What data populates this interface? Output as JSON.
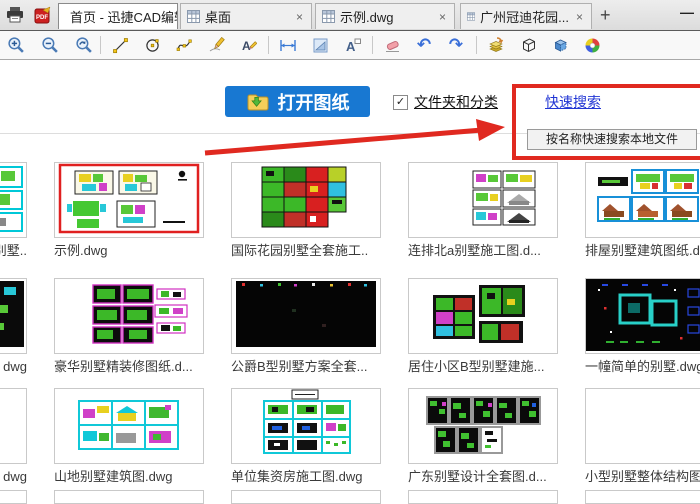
{
  "window": {
    "minimize_label": "—"
  },
  "tabs": {
    "close_label": "×",
    "new_tab_label": "+",
    "items": [
      {
        "label": "首页 - 迅捷CAD编辑器",
        "icon": "home-icon",
        "active": true
      },
      {
        "label": "桌面",
        "icon": "grid-document-icon",
        "active": false
      },
      {
        "label": "示例.dwg",
        "icon": "grid-document-icon",
        "active": false
      },
      {
        "label": "广州冠迪花园...",
        "icon": "grid-document-icon",
        "active": false
      }
    ]
  },
  "toolbar": {
    "tools": [
      "zoom-in",
      "zoom-out",
      "zoom-previous",
      "line",
      "circle",
      "spline",
      "sketch-pen",
      "text-edit",
      "dimension",
      "area-measure",
      "text",
      "eraser",
      "undo",
      "redo",
      "layers",
      "cube-wireframe",
      "cube-3d",
      "color-wheel"
    ]
  },
  "header": {
    "open_button_label": "打开图纸",
    "checkbox_label": "文件夹和分类",
    "checkbox_checked": "✓",
    "quick_search_label": "快速搜索",
    "tooltip": "按名称快速搜索本地文件",
    "annotation_color": "#e02920",
    "button_color": "#1878d2",
    "link_color": "#2136d4"
  },
  "grid": {
    "items": [
      {
        "label": "连别墅..",
        "partial": true
      },
      {
        "label": "示例.dwg",
        "selected": true
      },
      {
        "label": "国际花园别墅全套施工.."
      },
      {
        "label": "连排北a别墅施工图.d..."
      },
      {
        "label": "排屋别墅建筑图纸.d..."
      },
      {
        "label": "dwg",
        "partial": true
      },
      {
        "label": "豪华别墅精装修图纸.d..."
      },
      {
        "label": "公爵B型别墅方案全套..."
      },
      {
        "label": "居住小区B型别墅建施..."
      },
      {
        "label": "一幢简单的别墅.dwg"
      },
      {
        "label": "dwg",
        "partial": true
      },
      {
        "label": "山地别墅建筑图.dwg"
      },
      {
        "label": "单位集资房施工图.dwg"
      },
      {
        "label": "广东别墅设计全套图.d..."
      },
      {
        "label": "小型别墅整体结构图纸.."
      }
    ]
  }
}
